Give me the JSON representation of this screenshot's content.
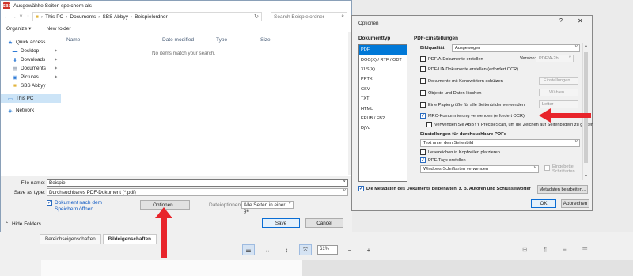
{
  "save_dialog": {
    "title": "Ausgewählte Seiten speichern als",
    "app_icon_text": "SBS",
    "breadcrumb": [
      "This PC",
      "Documents",
      "SBS Abbyy",
      "Beispielordner"
    ],
    "search_placeholder": "Search Beispielordner",
    "organize_label": "Organize ▾",
    "new_folder_label": "New folder",
    "nav_items": [
      {
        "label": "Quick access",
        "icon": "star-icon"
      },
      {
        "label": "Desktop",
        "icon": "desktop-icon"
      },
      {
        "label": "Downloads",
        "icon": "download-icon"
      },
      {
        "label": "Documents",
        "icon": "documents-icon"
      },
      {
        "label": "Pictures",
        "icon": "pictures-icon"
      },
      {
        "label": "SBS Abbyy",
        "icon": "folder-icon"
      },
      {
        "label": "This PC",
        "icon": "computer-icon"
      },
      {
        "label": "Network",
        "icon": "network-icon"
      }
    ],
    "columns": {
      "name": "Name",
      "date": "Date modified",
      "type": "Type",
      "size": "Size"
    },
    "empty_message": "No items match your search.",
    "file_name_label": "File name:",
    "file_name_value": "Beispiel",
    "save_type_label": "Save as type:",
    "save_type_value": "Durchsuchbares PDF-Dokument (*.pdf)",
    "open_after_label_1": "Dokument nach dem",
    "open_after_label_2": "Speichern öffnen",
    "options_button": "Optionen...",
    "file_options_label": "Dateioptionen:",
    "file_options_value": "Alle Seiten in einer ge",
    "save_button": "Save",
    "cancel_button": "Cancel",
    "hide_folders": "Hide Folders"
  },
  "options_dialog": {
    "title": "Optionen",
    "help": "?",
    "close": "✕",
    "doctype_header": "Dokumenttyp",
    "doctypes": [
      "PDF",
      "DOC(X) / RTF / ODT",
      "XLS(X)",
      "PPTX",
      "CSV",
      "TXT",
      "HTML",
      "EPUB / FB2",
      "DjVu"
    ],
    "selected_doctype": 0,
    "pdf_header": "PDF-Einstellungen",
    "quality_label": "Bildqualität:",
    "quality_value": "Ausgewogen",
    "pdfa_label": "PDF/A-Dokumente erstellen",
    "version_label": "Version:",
    "version_value": "PDF/A-2b",
    "pdfua_label": "PDF/UA-Dokumente erstellen (erfordert OCR)",
    "password_label": "Dokumente mit Kennwörtern schützen",
    "settings_button": "Einstellungen...",
    "delete_label": "Objekte und Daten löschen",
    "select_button": "Wählen...",
    "papersize_label": "Eine Papiergröße für alle Seitenbilder verwenden:",
    "papersize_value": "Letter",
    "mrc_label": "MRC-Komprimierung verwenden (erfordert OCR)",
    "precisescan_label": "Verwenden Sie ABBYY PreciseScan, um die Zeichen auf Seitenbildern zu glätten",
    "searchable_header": "Einstellungen für durchsuchbare PDFs",
    "text_mode_value": "Text unter dem Seitenbild",
    "bookmarks_label": "Lesezeichen in Kopfzeilen platzieren",
    "tags_label": "PDF-Tags erstellen",
    "fonts_value": "Windows-Schriftarten verwenden",
    "embed_fonts_1": "Eingebette",
    "embed_fonts_2": "Schriftarten",
    "metadata_label": "Die Metadaten des Dokuments beibehalten, z. B. Autoren und Schlüsselwörter",
    "metadata_button": "Metadaten bearbeiten...",
    "ok_button": "OK",
    "cancel_button": "Abbrechen",
    "checks": {
      "pdfa": false,
      "pdfua": false,
      "password": false,
      "delete": false,
      "papersize": false,
      "mrc": true,
      "precisescan": false,
      "bookmarks": false,
      "tags": true,
      "embed": false,
      "metadata": true
    }
  },
  "background": {
    "tabs": [
      "Bereichseigenschaften",
      "Bildeigenschaften"
    ],
    "zoom_value": "61%"
  },
  "colors": {
    "arrow": "#e8242b",
    "selection": "#0078d7",
    "nav_selected": "#cce4f7"
  }
}
